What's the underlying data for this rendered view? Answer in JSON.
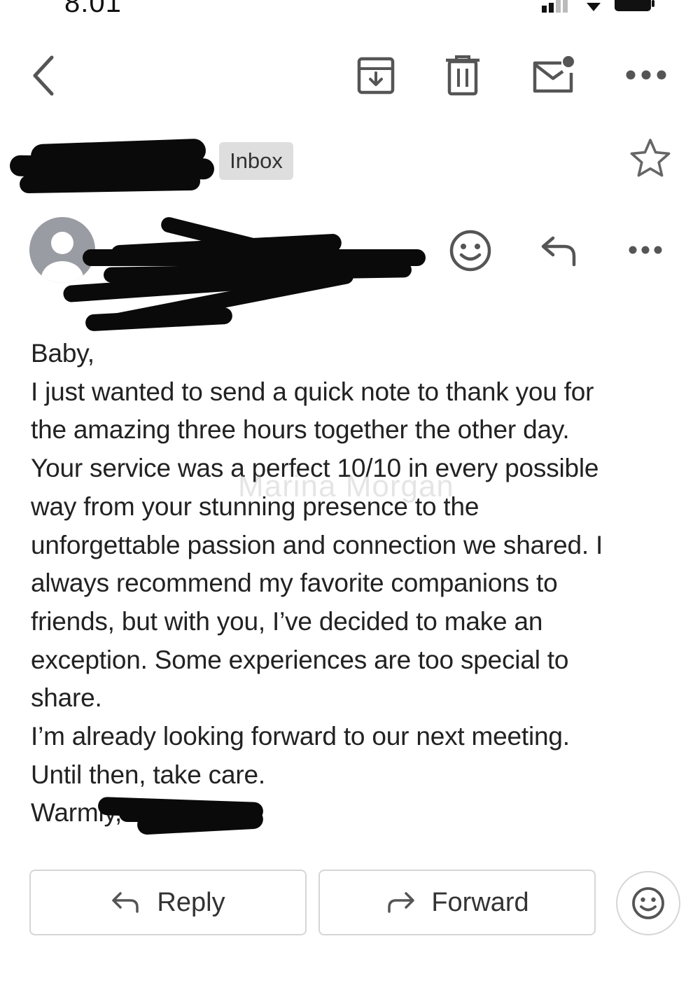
{
  "status_bar": {
    "time": "8:01",
    "icons": [
      "signal-icon",
      "wifi-icon",
      "battery-icon"
    ]
  },
  "toolbar": {
    "icons": [
      "back-chevron-icon",
      "archive-icon",
      "trash-icon",
      "mark-unread-icon",
      "more-horizontal-icon"
    ]
  },
  "header": {
    "label_badge": "Inbox",
    "star_icon": "star-outline-icon"
  },
  "sender_row": {
    "icons": [
      "avatar-placeholder-icon",
      "emoji-react-icon",
      "reply-icon",
      "more-horizontal-icon"
    ]
  },
  "email": {
    "lines": [
      "Baby,",
      "I just wanted to send a quick note to thank you for",
      "the amazing three hours together the other day.",
      "Your service was a perfect 10/10 in every possible",
      "way from your stunning presence to the",
      "unforgettable passion and connection we shared. I",
      "always recommend my favorite companions to",
      "friends, but with you, I’ve decided to make an",
      "exception. Some experiences are too special to",
      "share.",
      "I’m already looking forward to our next meeting.",
      "Until then, take care.",
      "Warmly,"
    ],
    "watermark": "Marina Morgan"
  },
  "actions": {
    "reply_label": "Reply",
    "forward_label": "Forward",
    "emoji_icon": "emoji-react-icon"
  },
  "colors": {
    "icon_gray": "#555555",
    "avatar_gray": "#9a9ca3",
    "badge_bg": "#dedede",
    "redaction": "#0a0a0a"
  }
}
